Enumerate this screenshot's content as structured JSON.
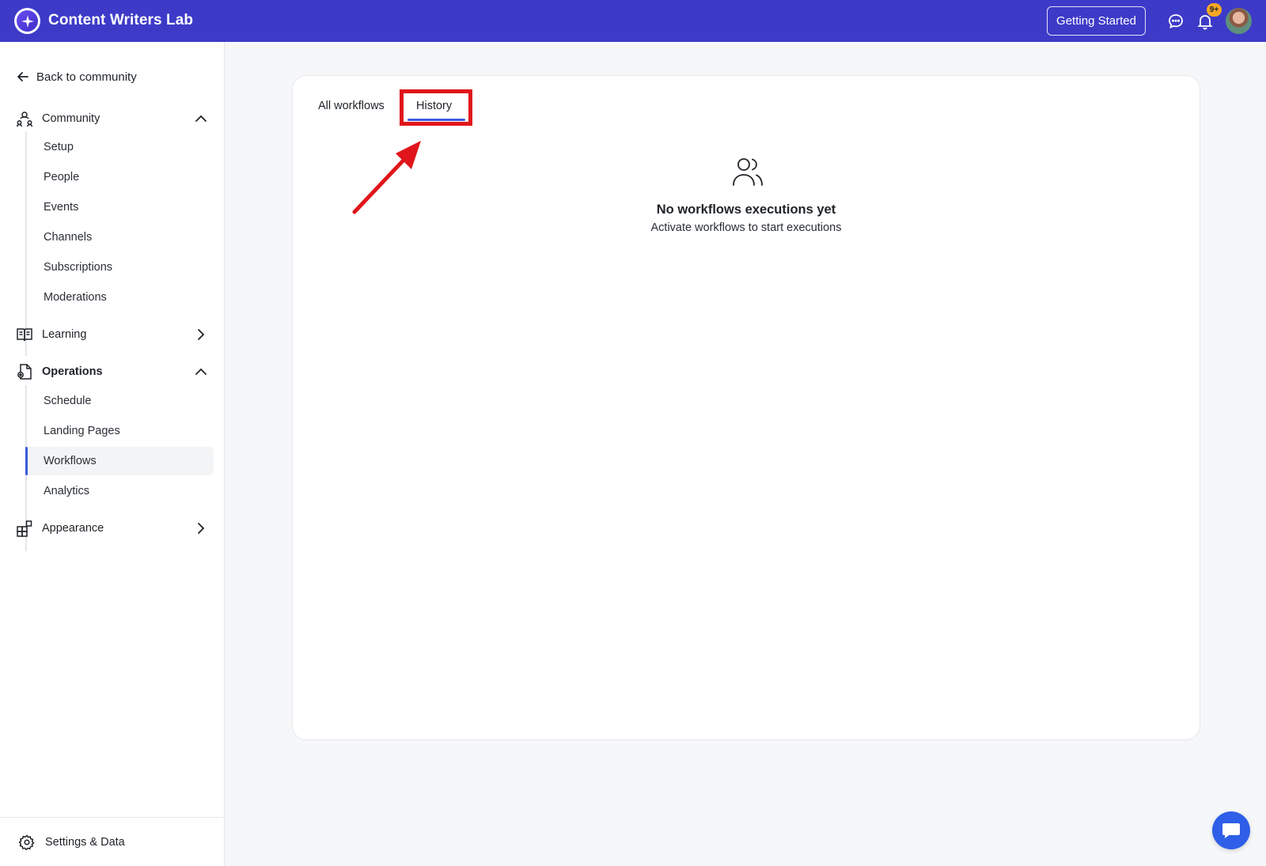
{
  "header": {
    "app_title": "Content Writers Lab",
    "logo_icon": "sparkle-logo-icon",
    "getting_started_label": "Getting Started",
    "chat_icon": "chat-bubble-icon",
    "bell_icon": "bell-icon",
    "notification_count": "9+",
    "colors": {
      "bar": "#3d3ac8",
      "badge": "#f5a623"
    }
  },
  "sidebar": {
    "back_label": "Back to community",
    "sections": [
      {
        "label": "Community",
        "icon": "community-icon",
        "expanded": true,
        "items": [
          "Setup",
          "People",
          "Events",
          "Channels",
          "Subscriptions",
          "Moderations"
        ]
      },
      {
        "label": "Learning",
        "icon": "book-icon",
        "expanded": false
      },
      {
        "label": "Operations",
        "icon": "operations-icon",
        "expanded": true,
        "items": [
          "Schedule",
          "Landing Pages",
          "Workflows",
          "Analytics"
        ],
        "active_item": "Workflows"
      },
      {
        "label": "Appearance",
        "icon": "appearance-icon",
        "expanded": false
      }
    ],
    "footer_label": "Settings & Data"
  },
  "main": {
    "tabs": [
      {
        "label": "All workflows",
        "active": false
      },
      {
        "label": "History",
        "active": true
      }
    ],
    "empty_state": {
      "icon": "users-icon",
      "title": "No workflows executions yet",
      "subtitle": "Activate workflows to start executions"
    },
    "annotation_color": "#e0161c",
    "accent_color": "#3b5bdb"
  },
  "fab_icon": "chat-launcher-icon"
}
